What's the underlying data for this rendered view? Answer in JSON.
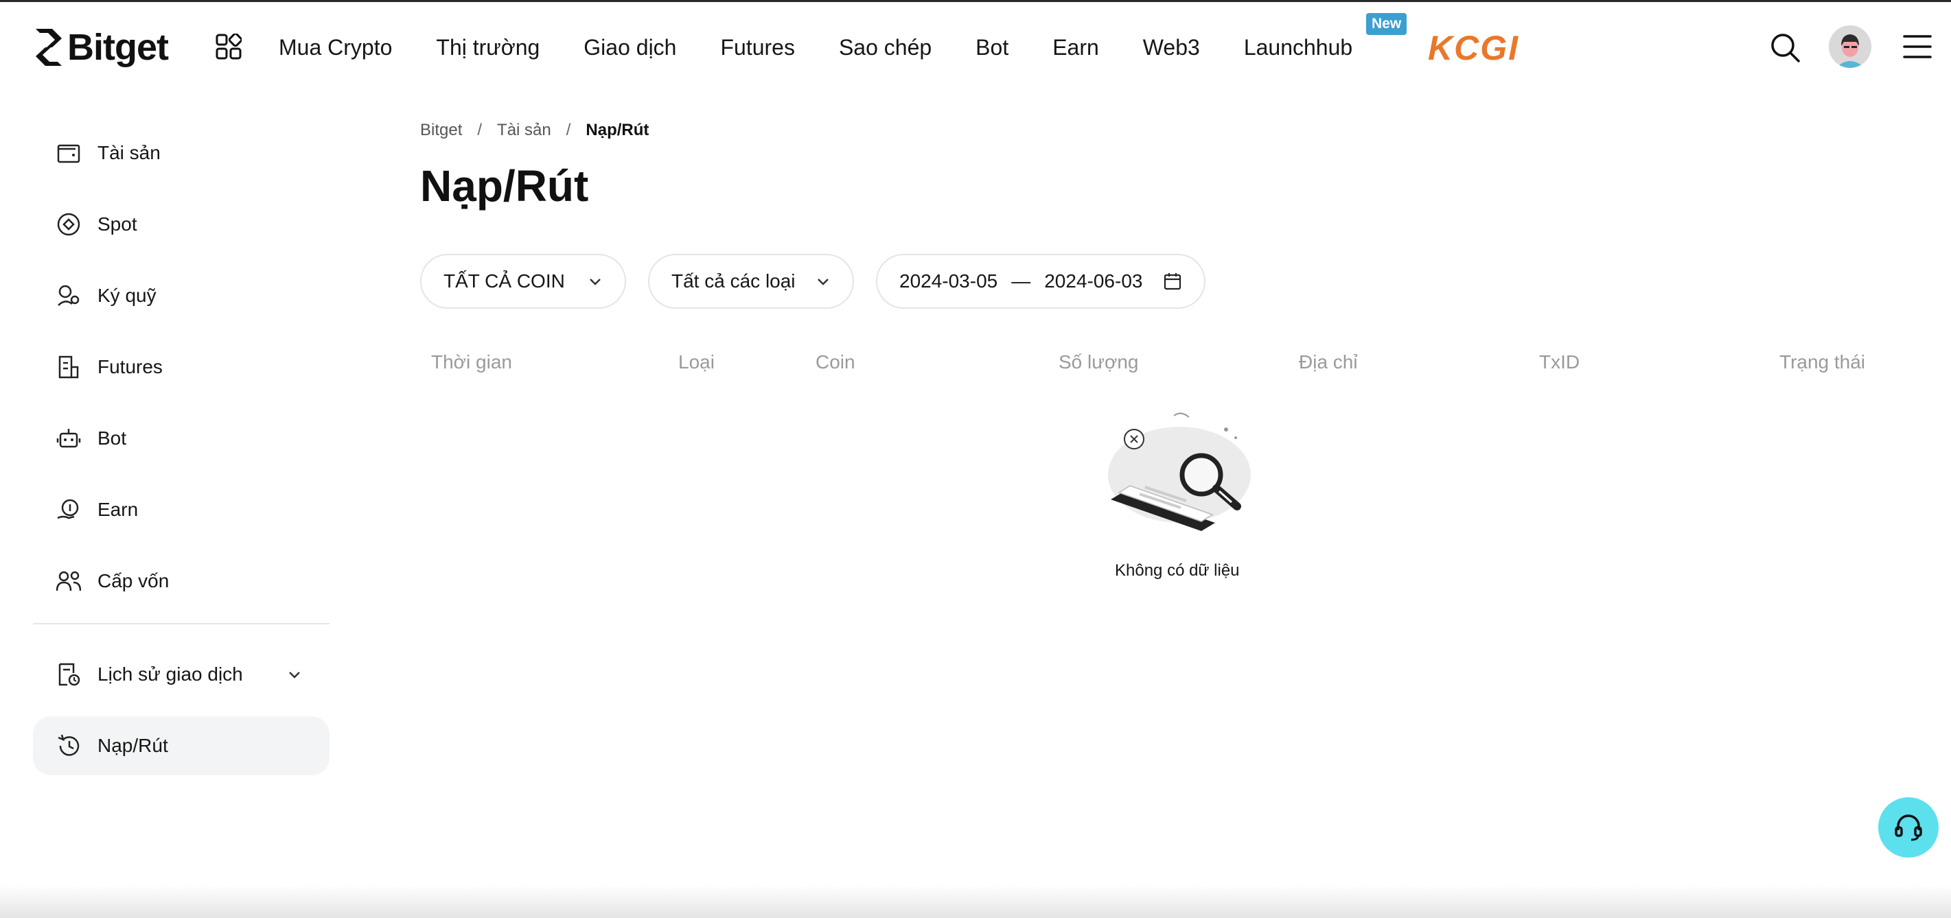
{
  "header": {
    "brand": "Bitget",
    "nav": [
      "Mua Crypto",
      "Thị trường",
      "Giao dịch",
      "Futures",
      "Sao chép",
      "Bot",
      "Earn",
      "Web3",
      "Launchhub"
    ],
    "new_badge": "New",
    "promo_logo": "KCGI",
    "icons": [
      "bitget-logo-icon",
      "apps-grid-icon",
      "search-icon",
      "avatar",
      "hamburger-menu-icon"
    ]
  },
  "sidebar": {
    "items": [
      {
        "label": "Tài sản",
        "icon": "wallet-icon"
      },
      {
        "label": "Spot",
        "icon": "spot-icon"
      },
      {
        "label": "Ký quỹ",
        "icon": "margin-icon"
      },
      {
        "label": "Futures",
        "icon": "futures-icon"
      },
      {
        "label": "Bot",
        "icon": "robot-icon"
      },
      {
        "label": "Earn",
        "icon": "earn-icon"
      },
      {
        "label": "Cấp vốn",
        "icon": "funding-icon"
      }
    ],
    "history": {
      "label": "Lịch sử giao dịch",
      "icon": "history-doc-icon"
    },
    "active": {
      "label": "Nạp/Rút",
      "icon": "history-clock-icon"
    }
  },
  "breadcrumb": {
    "items": [
      "Bitget",
      "Tài sản"
    ],
    "separator": "/",
    "current": "Nạp/Rút"
  },
  "page": {
    "title": "Nạp/Rút"
  },
  "filters": {
    "coin": "TẤT CẢ COIN",
    "type": "Tất cả các loại",
    "date_start": "2024-03-05",
    "date_sep": "—",
    "date_end": "2024-06-03"
  },
  "table": {
    "columns": [
      "Thời gian",
      "Loại",
      "Coin",
      "Số lượng",
      "Địa chỉ",
      "TxID",
      "Trạng thái"
    ],
    "rows": []
  },
  "empty": {
    "text": "Không có dữ liệu"
  },
  "colors": {
    "accent_cyan": "#5ce0ee",
    "kcgi_orange": "#e9782b",
    "badge_blue": "#3b9fd0"
  }
}
